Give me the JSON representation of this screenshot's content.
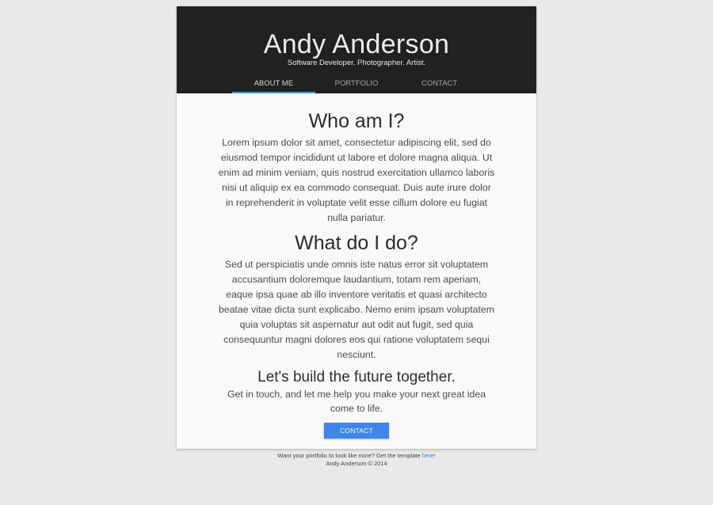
{
  "header": {
    "title": "Andy Anderson",
    "subtitle": "Software Developer. Photographer. Artist."
  },
  "nav": {
    "tabs": [
      {
        "label": "ABOUT ME",
        "active": true
      },
      {
        "label": "PORTFOLIO",
        "active": false
      },
      {
        "label": "CONTACT",
        "active": false
      }
    ]
  },
  "sections": [
    {
      "heading": "Who am I?",
      "body": "Lorem ipsum dolor sit amet, consectetur adipiscing elit, sed do eiusmod tempor incididunt ut labore et dolore magna aliqua. Ut enim ad minim veniam, quis nostrud exercitation ullamco laboris nisi ut aliquip ex ea commodo consequat. Duis aute irure dolor in reprehenderit in voluptate velit esse cillum dolore eu fugiat nulla pariatur."
    },
    {
      "heading": "What do I do?",
      "body": "Sed ut perspiciatis unde omnis iste natus error sit voluptatem accusantium doloremque laudantium, totam rem aperiam, eaque ipsa quae ab illo inventore veritatis et quasi architecto beatae vitae dicta sunt explicabo. Nemo enim ipsam voluptatem quia voluptas sit aspernatur aut odit aut fugit, sed quia consequuntur magni dolores eos qui ratione voluptatem sequi nesciunt."
    }
  ],
  "cta": {
    "heading": "Let's build the future together.",
    "body": "Get in touch, and let me help you make your next great idea come to life.",
    "button_label": "CONTACT"
  },
  "footer": {
    "template_text": "Want your portfolio to look like mine? Get the template",
    "template_link": "here!",
    "copyright": "Andy Anderson © 2014"
  },
  "colors": {
    "header_bg": "#212121",
    "page_bg": "#e9e9e9",
    "card_bg": "#f9f9f9",
    "tab_indicator": "#39a0f1",
    "button_bg": "#3f86ea",
    "link": "#3f7fd8"
  }
}
